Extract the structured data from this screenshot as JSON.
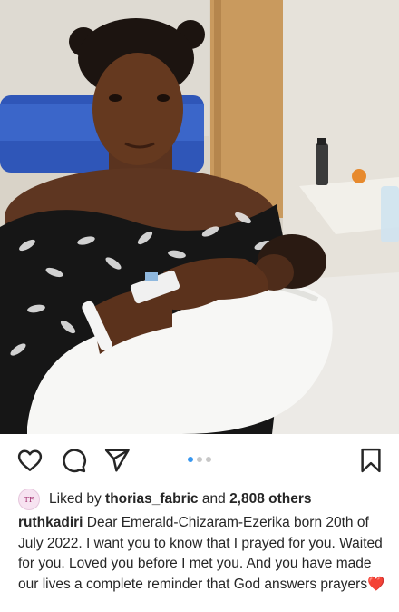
{
  "post": {
    "actions": {
      "like_icon": "heart-outline-icon",
      "comment_icon": "comment-bubble-icon",
      "share_icon": "paper-plane-icon",
      "save_icon": "bookmark-icon"
    },
    "carousel": {
      "count": 3,
      "active_index": 0
    },
    "likes": {
      "prefix": "Liked by",
      "user": "thorias_fabric",
      "joiner": "and",
      "others": "2,808 others"
    },
    "caption": {
      "username": "ruthkadiri",
      "text": "Dear Emerald-Chizaram-Ezerika  born 20th of July 2022. I want you to know that I prayed for you. Waited for you. Loved you before I met you. And you have made our lives a complete reminder that God answers prayers",
      "emoji": "❤️"
    },
    "colors": {
      "accent": "#3797f0",
      "text": "#262626",
      "dot_inactive": "#c7c7c7"
    }
  }
}
